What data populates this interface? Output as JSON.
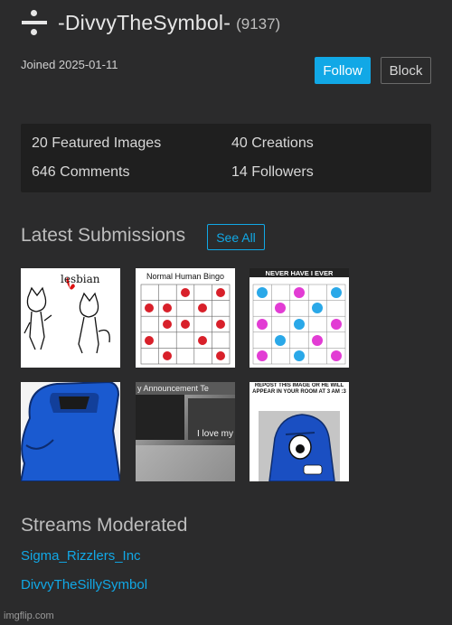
{
  "profile": {
    "username": "-DivvyTheSymbol-",
    "points": "(9137)",
    "icon": "divide-icon",
    "joined": "Joined 2025-01-11"
  },
  "actions": {
    "follow_label": "Follow",
    "block_label": "Block"
  },
  "stats": {
    "featured": "20 Featured Images",
    "creations": "40 Creations",
    "comments": "646 Comments",
    "followers": "14 Followers"
  },
  "latest": {
    "title": "Latest Submissions",
    "see_all": "See All",
    "thumbs": [
      {
        "kind": "sketch",
        "caption": "lesbian"
      },
      {
        "kind": "bingo",
        "caption": "Normal Human Bingo"
      },
      {
        "kind": "never",
        "caption": "NEVER HAVE I EVER"
      },
      {
        "kind": "blue-creature",
        "caption": ""
      },
      {
        "kind": "announcement",
        "caption": "y Announcement Te",
        "text": "I love my hubby sm"
      },
      {
        "kind": "repost",
        "caption": "REPOST THIS IMAGE OR HE WILL APPEAR IN YOUR ROOM AT 3 AM :3"
      }
    ]
  },
  "streams": {
    "title": "Streams Moderated",
    "items": [
      "Sigma_Rizzlers_Inc",
      "DivvyTheSillySymbol"
    ]
  },
  "watermark": "imgflip.com",
  "colors": {
    "accent": "#11a8e6",
    "background": "#2b2b2c",
    "panel": "#1f1f1f"
  }
}
